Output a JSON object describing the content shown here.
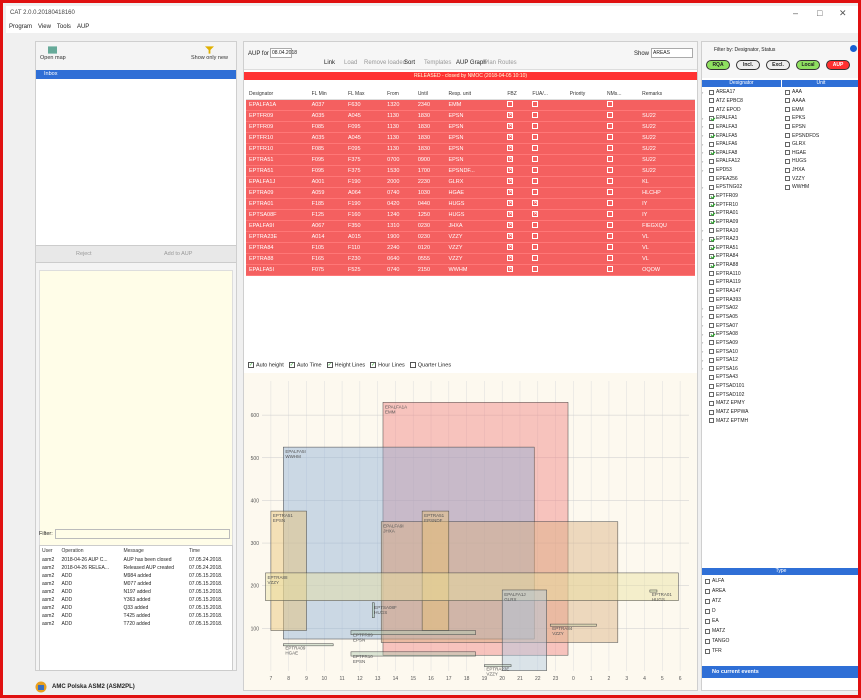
{
  "app": {
    "title": "CAT 2.0.0.20180418160"
  },
  "menu": [
    "Program",
    "View",
    "Tools",
    "AUP"
  ],
  "left": {
    "open_map": "Open map",
    "show_only_new": "Show only new",
    "inbox": "Inbox",
    "reject": "Reject",
    "add_to_aup": "Add to AUP",
    "filter_label": "Filter:"
  },
  "log": {
    "headers": [
      "User",
      "Operation",
      "Message",
      "Time"
    ],
    "rows": [
      [
        "asm2",
        "2018-04-26 AUP C...",
        "AUP has been closed",
        "07.05.24.2018."
      ],
      [
        "asm2",
        "2018-04-26 RELEA...",
        "Released AUP created",
        "07.05.24.2018."
      ],
      [
        "asm2",
        "ADD",
        "M984 added",
        "07.05.15.2018."
      ],
      [
        "asm2",
        "ADD",
        "M077 added",
        "07.05.15.2018."
      ],
      [
        "asm2",
        "ADD",
        "N197 added",
        "07.05.15.2018."
      ],
      [
        "asm2",
        "ADD",
        "Y363 added",
        "07.05.15.2018."
      ],
      [
        "asm2",
        "ADD",
        "Q33 added",
        "07.05.15.2018."
      ],
      [
        "asm2",
        "ADD",
        "T425 added",
        "07.05.15.2018."
      ],
      [
        "asm2",
        "ADD",
        "T720 added",
        "07.05.15.2018."
      ]
    ]
  },
  "status": "AMC Polska ASM2 (ASM2PL)",
  "toolbar": {
    "aup_for": "AUP for",
    "date": "08.04.2018",
    "link": "Link",
    "load": "Load",
    "remove_loaded": "Remove loaded",
    "sort": "Sort",
    "templates": "Templates",
    "aup_graph": "AUP Graph",
    "plan_routes": "Plan Routes",
    "show": "Show",
    "show_value": "AREAS"
  },
  "released": "RELEASED - closed by NMOC (2018-04-05 10:10)",
  "grid": {
    "headers": [
      "Designator",
      "FL Min",
      "FL Max",
      "From",
      "Until",
      "Resp. unit",
      "FBZ",
      "FUA/...",
      "Priority",
      "NMs...",
      "Remarks"
    ],
    "rows": [
      [
        "EPALFA1A",
        "A037",
        "F630",
        "1320",
        "2340",
        "EMM",
        "",
        "",
        "",
        "",
        ""
      ],
      [
        "EPTFR09",
        "A035",
        "A045",
        "1130",
        "1830",
        "EPSN",
        "x",
        "",
        "",
        "",
        "SU22"
      ],
      [
        "EPTFR09",
        "F085",
        "F095",
        "1130",
        "1830",
        "EPSN",
        "x",
        "",
        "",
        "",
        "SU22"
      ],
      [
        "EPTFR10",
        "A035",
        "A045",
        "1130",
        "1830",
        "EPSN",
        "x",
        "",
        "",
        "",
        "SU22"
      ],
      [
        "EPTFR10",
        "F085",
        "F095",
        "1130",
        "1830",
        "EPSN",
        "x",
        "",
        "",
        "",
        "SU22"
      ],
      [
        "EPTRA51",
        "F095",
        "F375",
        "0700",
        "0900",
        "EPSN",
        "x",
        "",
        "",
        "",
        "SU22"
      ],
      [
        "EPTRA51",
        "F095",
        "F375",
        "1530",
        "1700",
        "EPSNDF...",
        "x",
        "",
        "",
        "",
        "SU22"
      ],
      [
        "EPALFA1J",
        "A001",
        "F190",
        "2000",
        "2230",
        "GLRX",
        "x",
        "",
        "",
        "",
        "KL"
      ],
      [
        "EPTRA09",
        "A059",
        "A064",
        "0740",
        "1030",
        "HGAE",
        "x",
        "",
        "",
        "",
        "HLCHP"
      ],
      [
        "EPTRA01",
        "F185",
        "F190",
        "0420",
        "0440",
        "HUGS",
        "x",
        "x",
        "",
        "",
        "IY"
      ],
      [
        "EPTSA08F",
        "F125",
        "F160",
        "1240",
        "1250",
        "HUGS",
        "x",
        "x",
        "",
        "",
        "IY"
      ],
      [
        "EPALFA9I",
        "A067",
        "F350",
        "1310",
        "0230",
        "JHXA",
        "x",
        "",
        "",
        "",
        "FIEGXQU"
      ],
      [
        "EPTRA23E",
        "A014",
        "A015",
        "1900",
        "0230",
        "VZZY",
        "x",
        "",
        "",
        "",
        "VL"
      ],
      [
        "EPTRA84",
        "F105",
        "F110",
        "2240",
        "0120",
        "VZZY",
        "x",
        "",
        "",
        "",
        "VL"
      ],
      [
        "EPTRA88",
        "F165",
        "F230",
        "0640",
        "0555",
        "VZZY",
        "x",
        "",
        "",
        "",
        "VL"
      ],
      [
        "EPALFA5I",
        "F075",
        "F525",
        "0740",
        "2150",
        "WWHM",
        "x",
        "",
        "",
        "",
        "OQOW"
      ]
    ]
  },
  "chart_opts": [
    "Auto height",
    "Auto Time",
    "Height Lines",
    "Hour Lines",
    "Quarter Lines"
  ],
  "chart_data": {
    "type": "table",
    "y_ticks": [
      100,
      200,
      300,
      400,
      500,
      600
    ],
    "x_ticks": [
      "7",
      "8",
      "9",
      "10",
      "11",
      "12",
      "13",
      "14",
      "15",
      "16",
      "17",
      "18",
      "19",
      "20",
      "21",
      "22",
      "23",
      "0",
      "1",
      "2",
      "3",
      "4",
      "5",
      "6"
    ],
    "areas": [
      {
        "label": "EPALFA1A\nEMM",
        "t0": 13.3,
        "t1": 23.7,
        "lo": 37,
        "hi": 630,
        "color": "#f08080"
      },
      {
        "label": "EPALFA5I\nWWHM",
        "t0": 7.7,
        "t1": 21.8,
        "lo": 75,
        "hi": 525,
        "color": "#8fb0d8"
      },
      {
        "label": "EPTRA51\nEPSN",
        "t0": 7.0,
        "t1": 9.0,
        "lo": 95,
        "hi": 375,
        "color": "#e8c070"
      },
      {
        "label": "EPALFA9I\nJHXA",
        "t0": 13.2,
        "t1": 26.5,
        "lo": 67,
        "hi": 350,
        "color": "#d9b080"
      },
      {
        "label": "EPTRA51\nEPSNDF",
        "t0": 15.5,
        "t1": 17.0,
        "lo": 95,
        "hi": 375,
        "color": "#e8c070"
      },
      {
        "label": "EPTRA88\nVZZY",
        "t0": 6.7,
        "t1": 29.9,
        "lo": 165,
        "hi": 230,
        "color": "#e8e0a0"
      },
      {
        "label": "EPTRA01\nHUGS",
        "t0": 28.3,
        "t1": 28.7,
        "lo": 185,
        "hi": 190,
        "color": "#c8d8a8"
      },
      {
        "label": "EPALFA1J\nGLRX",
        "t0": 20.0,
        "t1": 22.5,
        "lo": 1,
        "hi": 190,
        "color": "#b0c8e0"
      },
      {
        "label": "EPTSA08F\nHUGS",
        "t0": 12.7,
        "t1": 12.8,
        "lo": 125,
        "hi": 160,
        "color": "#a8d0b0"
      },
      {
        "label": "EPTRA84\nVZZY",
        "t0": 22.7,
        "t1": 25.3,
        "lo": 105,
        "hi": 110,
        "color": "#c8d8a8"
      },
      {
        "label": "EPTFR09\nEPSN",
        "t0": 11.5,
        "t1": 18.5,
        "lo": 85,
        "hi": 95,
        "color": "#b0c8b0"
      },
      {
        "label": "EPTRA09\nHGAE",
        "t0": 7.7,
        "t1": 10.5,
        "lo": 59,
        "hi": 64,
        "color": "#b0c8b0"
      },
      {
        "label": "EPTFR10\nEPSN",
        "t0": 11.5,
        "t1": 18.5,
        "lo": 35,
        "hi": 45,
        "color": "#b0c8b0"
      },
      {
        "label": "EPTRA23E\nVZZY",
        "t0": 19.0,
        "t1": 20.5,
        "lo": 14,
        "hi": 15,
        "color": "#b0c8b0"
      }
    ]
  },
  "right": {
    "filter_label": "Filter by: Designator, Status",
    "pills": [
      "RQA",
      "Incl.",
      "Excl.",
      "Local",
      "AUP"
    ],
    "designator_hdr": "Designator",
    "unit_hdr": "Unit",
    "type_hdr": "Type",
    "events": "No current events",
    "designators": [
      [
        "AREA17",
        false,
        true
      ],
      [
        "ATZ EPBC8",
        false,
        false
      ],
      [
        "ATZ EPOD",
        false,
        false
      ],
      [
        "EPALFA1",
        true,
        true
      ],
      [
        "EPALFA3",
        false,
        true
      ],
      [
        "EPALFA5",
        true,
        true
      ],
      [
        "EPALFA6",
        false,
        true
      ],
      [
        "EPALFA8",
        true,
        true
      ],
      [
        "EPALFA12",
        false,
        true
      ],
      [
        "EPD53",
        false,
        true
      ],
      [
        "EPEA256",
        false,
        false
      ],
      [
        "EPSTNG02",
        false,
        true
      ],
      [
        "EPTFR09",
        true,
        false
      ],
      [
        "EPTFR10",
        true,
        false
      ],
      [
        "EPTRA01",
        true,
        false
      ],
      [
        "EPTRA09",
        true,
        false
      ],
      [
        "EPTRA10",
        false,
        true
      ],
      [
        "EPTRA23",
        true,
        true
      ],
      [
        "EPTRA51",
        true,
        false
      ],
      [
        "EPTRA84",
        true,
        false
      ],
      [
        "EPTRA88",
        true,
        false
      ],
      [
        "EPTRA110",
        false,
        false
      ],
      [
        "EPTRA119",
        false,
        false
      ],
      [
        "EPTRA147",
        false,
        false
      ],
      [
        "EPTRA393",
        false,
        false
      ],
      [
        "EPTSA02",
        false,
        true
      ],
      [
        "EPTSA05",
        false,
        true
      ],
      [
        "EPTSA07",
        false,
        true
      ],
      [
        "EPTSA08",
        true,
        true
      ],
      [
        "EPTSA09",
        false,
        true
      ],
      [
        "EPTSA10",
        false,
        true
      ],
      [
        "EPTSA12",
        false,
        true
      ],
      [
        "EPTSA16",
        false,
        true
      ],
      [
        "EPTSA43",
        false,
        false
      ],
      [
        "EPTSAD101",
        false,
        false
      ],
      [
        "EPTSAD102",
        false,
        false
      ],
      [
        "MATZ EPMY",
        false,
        false
      ],
      [
        "MATZ EPPWA",
        false,
        false
      ],
      [
        "MATZ EPTMH",
        false,
        false
      ]
    ],
    "units": [
      "AAA",
      "AAAA",
      "EMM",
      "EPKS",
      "EPSN",
      "EPSNDFDS",
      "GLRX",
      "HGAE",
      "HUGS",
      "JHXA",
      "VZZY",
      "WWHM"
    ],
    "types": [
      "ALFA",
      "AREA",
      "ATZ",
      "D",
      "EA",
      "MATZ",
      "TANGO",
      "TFR"
    ]
  }
}
